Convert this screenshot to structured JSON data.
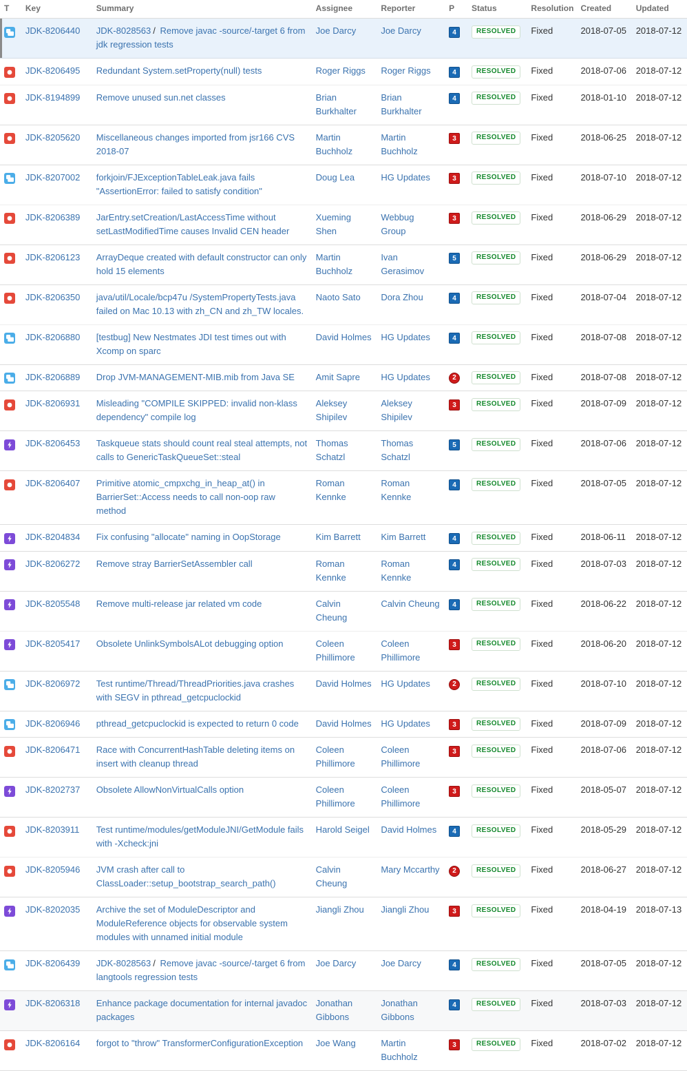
{
  "table": {
    "columns": [
      {
        "key": "type",
        "label": "T"
      },
      {
        "key": "key",
        "label": "Key"
      },
      {
        "key": "summary",
        "label": "Summary"
      },
      {
        "key": "assignee",
        "label": "Assignee"
      },
      {
        "key": "reporter",
        "label": "Reporter"
      },
      {
        "key": "priority",
        "label": "P"
      },
      {
        "key": "status",
        "label": "Status"
      },
      {
        "key": "resolution",
        "label": "Resolution"
      },
      {
        "key": "created",
        "label": "Created"
      },
      {
        "key": "updated",
        "label": "Updated"
      }
    ],
    "colors": {
      "link": "#3b73af",
      "subtask_icon": "#4bade8",
      "bug_icon": "#e5493a",
      "enhancement_icon": "#7d4bd8",
      "priority_blue": "#1b6bb5",
      "priority_red": "#cf1b1b",
      "status_resolved_text": "#14892c",
      "selected_row_bg": "#e9f2fb"
    },
    "rows": [
      {
        "type": "subtask",
        "type_label": "Sub-task",
        "key": "JDK-8206440",
        "summary_prefix": "JDK-8028563",
        "summary": "Remove javac -source/-target 6 from jdk regression tests",
        "assignee": "Joe Darcy",
        "reporter": "Joe Darcy",
        "priority": "4",
        "priority_shape": "square",
        "status": "RESOLVED",
        "resolution": "Fixed",
        "created": "2018-07-05",
        "updated": "2018-07-12",
        "selected": true,
        "alt": false,
        "sep": true
      },
      {
        "type": "bug",
        "type_label": "Bug",
        "key": "JDK-8206495",
        "summary_prefix": "",
        "summary": "Redundant System.setProperty(null) tests",
        "assignee": "Roger Riggs",
        "reporter": "Roger Riggs",
        "priority": "4",
        "priority_shape": "square",
        "status": "RESOLVED",
        "resolution": "Fixed",
        "created": "2018-07-06",
        "updated": "2018-07-12",
        "selected": false,
        "alt": false,
        "sep": false
      },
      {
        "type": "bug",
        "type_label": "Bug",
        "key": "JDK-8194899",
        "summary_prefix": "",
        "summary": "Remove unused sun.net classes",
        "assignee": "Brian Burkhalter",
        "reporter": "Brian Burkhalter",
        "priority": "4",
        "priority_shape": "square",
        "status": "RESOLVED",
        "resolution": "Fixed",
        "created": "2018-01-10",
        "updated": "2018-07-12",
        "selected": false,
        "alt": false,
        "sep": true
      },
      {
        "type": "bug",
        "type_label": "Bug",
        "key": "JDK-8205620",
        "summary_prefix": "",
        "summary": "Miscellaneous changes imported from jsr166 CVS 2018-07",
        "assignee": "Martin Buchholz",
        "reporter": "Martin Buchholz",
        "priority": "3",
        "priority_shape": "square",
        "status": "RESOLVED",
        "resolution": "Fixed",
        "created": "2018-06-25",
        "updated": "2018-07-12",
        "selected": false,
        "alt": false,
        "sep": true
      },
      {
        "type": "subtask",
        "type_label": "Sub-task",
        "key": "JDK-8207002",
        "summary_prefix": "",
        "summary": "forkjoin/FJExceptionTableLeak.java fails \"AssertionError: failed to satisfy condition\"",
        "assignee": "Doug Lea",
        "reporter": "HG Updates",
        "priority": "3",
        "priority_shape": "square",
        "status": "RESOLVED",
        "resolution": "Fixed",
        "created": "2018-07-10",
        "updated": "2018-07-12",
        "selected": false,
        "alt": false,
        "sep": false
      },
      {
        "type": "bug",
        "type_label": "Bug",
        "key": "JDK-8206389",
        "summary_prefix": "",
        "summary": "JarEntry.setCreation/LastAccessTime without setLastModifiedTime causes Invalid CEN header",
        "assignee": "Xueming Shen",
        "reporter": "Webbug Group",
        "priority": "3",
        "priority_shape": "square",
        "status": "RESOLVED",
        "resolution": "Fixed",
        "created": "2018-06-29",
        "updated": "2018-07-12",
        "selected": false,
        "alt": false,
        "sep": true
      },
      {
        "type": "bug",
        "type_label": "Bug",
        "key": "JDK-8206123",
        "summary_prefix": "",
        "summary": "ArrayDeque created with default constructor can only hold 15 elements",
        "assignee": "Martin Buchholz",
        "reporter": "Ivan Gerasimov",
        "priority": "5",
        "priority_shape": "square",
        "status": "RESOLVED",
        "resolution": "Fixed",
        "created": "2018-06-29",
        "updated": "2018-07-12",
        "selected": false,
        "alt": false,
        "sep": true
      },
      {
        "type": "bug",
        "type_label": "Bug",
        "key": "JDK-8206350",
        "summary_prefix": "",
        "summary": "java/util/Locale/bcp47u /SystemPropertyTests.java failed on Mac 10.13 with zh_CN and zh_TW locales.",
        "assignee": "Naoto Sato",
        "reporter": "Dora Zhou",
        "priority": "4",
        "priority_shape": "square",
        "status": "RESOLVED",
        "resolution": "Fixed",
        "created": "2018-07-04",
        "updated": "2018-07-12",
        "selected": false,
        "alt": false,
        "sep": false
      },
      {
        "type": "subtask",
        "type_label": "Sub-task",
        "key": "JDK-8206880",
        "summary_prefix": "",
        "summary": "[testbug] New Nestmates JDI test times out with Xcomp on sparc",
        "assignee": "David Holmes",
        "reporter": "HG Updates",
        "priority": "4",
        "priority_shape": "square",
        "status": "RESOLVED",
        "resolution": "Fixed",
        "created": "2018-07-08",
        "updated": "2018-07-12",
        "selected": false,
        "alt": false,
        "sep": true
      },
      {
        "type": "subtask",
        "type_label": "Sub-task",
        "key": "JDK-8206889",
        "summary_prefix": "",
        "summary": "Drop JVM-MANAGEMENT-MIB.mib from Java SE",
        "assignee": "Amit Sapre",
        "reporter": "HG Updates",
        "priority": "2",
        "priority_shape": "circle",
        "status": "RESOLVED",
        "resolution": "Fixed",
        "created": "2018-07-08",
        "updated": "2018-07-12",
        "selected": false,
        "alt": false,
        "sep": true
      },
      {
        "type": "bug",
        "type_label": "Bug",
        "key": "JDK-8206931",
        "summary_prefix": "",
        "summary": "Misleading \"COMPILE SKIPPED: invalid non-klass dependency\" compile log",
        "assignee": "Aleksey Shipilev",
        "reporter": "Aleksey Shipilev",
        "priority": "3",
        "priority_shape": "square",
        "status": "RESOLVED",
        "resolution": "Fixed",
        "created": "2018-07-09",
        "updated": "2018-07-12",
        "selected": false,
        "alt": false,
        "sep": true
      },
      {
        "type": "enhancement",
        "type_label": "Enhancement",
        "key": "JDK-8206453",
        "summary_prefix": "",
        "summary": "Taskqueue stats should count real steal attempts, not calls to GenericTaskQueueSet::steal",
        "assignee": "Thomas Schatzl",
        "reporter": "Thomas Schatzl",
        "priority": "5",
        "priority_shape": "square",
        "status": "RESOLVED",
        "resolution": "Fixed",
        "created": "2018-07-06",
        "updated": "2018-07-12",
        "selected": false,
        "alt": false,
        "sep": true
      },
      {
        "type": "bug",
        "type_label": "Bug",
        "key": "JDK-8206407",
        "summary_prefix": "",
        "summary": "Primitive atomic_cmpxchg_in_heap_at() in BarrierSet::Access needs to call non-oop raw method",
        "assignee": "Roman Kennke",
        "reporter": "Roman Kennke",
        "priority": "4",
        "priority_shape": "square",
        "status": "RESOLVED",
        "resolution": "Fixed",
        "created": "2018-07-05",
        "updated": "2018-07-12",
        "selected": false,
        "alt": false,
        "sep": true
      },
      {
        "type": "enhancement",
        "type_label": "Enhancement",
        "key": "JDK-8204834",
        "summary_prefix": "",
        "summary": "Fix confusing \"allocate\" naming in OopStorage",
        "assignee": "Kim Barrett",
        "reporter": "Kim Barrett",
        "priority": "4",
        "priority_shape": "square",
        "status": "RESOLVED",
        "resolution": "Fixed",
        "created": "2018-06-11",
        "updated": "2018-07-12",
        "selected": false,
        "alt": false,
        "sep": true
      },
      {
        "type": "enhancement",
        "type_label": "Enhancement",
        "key": "JDK-8206272",
        "summary_prefix": "",
        "summary": "Remove stray BarrierSetAssembler call",
        "assignee": "Roman Kennke",
        "reporter": "Roman Kennke",
        "priority": "4",
        "priority_shape": "square",
        "status": "RESOLVED",
        "resolution": "Fixed",
        "created": "2018-07-03",
        "updated": "2018-07-12",
        "selected": false,
        "alt": false,
        "sep": true
      },
      {
        "type": "enhancement",
        "type_label": "Enhancement",
        "key": "JDK-8205548",
        "summary_prefix": "",
        "summary": "Remove multi-release jar related vm code",
        "assignee": "Calvin Cheung",
        "reporter": "Calvin Cheung",
        "priority": "4",
        "priority_shape": "square",
        "status": "RESOLVED",
        "resolution": "Fixed",
        "created": "2018-06-22",
        "updated": "2018-07-12",
        "selected": false,
        "alt": false,
        "sep": false
      },
      {
        "type": "enhancement",
        "type_label": "Enhancement",
        "key": "JDK-8205417",
        "summary_prefix": "",
        "summary": "Obsolete UnlinkSymbolsALot debugging option",
        "assignee": "Coleen Phillimore",
        "reporter": "Coleen Phillimore",
        "priority": "3",
        "priority_shape": "square",
        "status": "RESOLVED",
        "resolution": "Fixed",
        "created": "2018-06-20",
        "updated": "2018-07-12",
        "selected": false,
        "alt": false,
        "sep": true
      },
      {
        "type": "subtask",
        "type_label": "Sub-task",
        "key": "JDK-8206972",
        "summary_prefix": "",
        "summary": "Test runtime/Thread/ThreadPriorities.java crashes with SEGV in pthread_getcpuclockid",
        "assignee": "David Holmes",
        "reporter": "HG Updates",
        "priority": "2",
        "priority_shape": "circle",
        "status": "RESOLVED",
        "resolution": "Fixed",
        "created": "2018-07-10",
        "updated": "2018-07-12",
        "selected": false,
        "alt": false,
        "sep": true
      },
      {
        "type": "subtask",
        "type_label": "Sub-task",
        "key": "JDK-8206946",
        "summary_prefix": "",
        "summary": "pthread_getcpuclockid is expected to return 0 code",
        "assignee": "David Holmes",
        "reporter": "HG Updates",
        "priority": "3",
        "priority_shape": "square",
        "status": "RESOLVED",
        "resolution": "Fixed",
        "created": "2018-07-09",
        "updated": "2018-07-12",
        "selected": false,
        "alt": false,
        "sep": true
      },
      {
        "type": "bug",
        "type_label": "Bug",
        "key": "JDK-8206471",
        "summary_prefix": "",
        "summary": "Race with ConcurrentHashTable deleting items on insert with cleanup thread",
        "assignee": "Coleen Phillimore",
        "reporter": "Coleen Phillimore",
        "priority": "3",
        "priority_shape": "square",
        "status": "RESOLVED",
        "resolution": "Fixed",
        "created": "2018-07-06",
        "updated": "2018-07-12",
        "selected": false,
        "alt": false,
        "sep": true
      },
      {
        "type": "enhancement",
        "type_label": "Enhancement",
        "key": "JDK-8202737",
        "summary_prefix": "",
        "summary": "Obsolete AllowNonVirtualCalls option",
        "assignee": "Coleen Phillimore",
        "reporter": "Coleen Phillimore",
        "priority": "3",
        "priority_shape": "square",
        "status": "RESOLVED",
        "resolution": "Fixed",
        "created": "2018-05-07",
        "updated": "2018-07-12",
        "selected": false,
        "alt": false,
        "sep": true
      },
      {
        "type": "bug",
        "type_label": "Bug",
        "key": "JDK-8203911",
        "summary_prefix": "",
        "summary": "Test runtime/modules/getModuleJNI/GetModule fails with -Xcheck:jni",
        "assignee": "Harold Seigel",
        "reporter": "David Holmes",
        "priority": "4",
        "priority_shape": "square",
        "status": "RESOLVED",
        "resolution": "Fixed",
        "created": "2018-05-29",
        "updated": "2018-07-12",
        "selected": false,
        "alt": false,
        "sep": false
      },
      {
        "type": "bug",
        "type_label": "Bug",
        "key": "JDK-8205946",
        "summary_prefix": "",
        "summary": "JVM crash after call to ClassLoader::setup_bootstrap_search_path()",
        "assignee": "Calvin Cheung",
        "reporter": "Mary Mccarthy",
        "priority": "2",
        "priority_shape": "circle",
        "status": "RESOLVED",
        "resolution": "Fixed",
        "created": "2018-06-27",
        "updated": "2018-07-12",
        "selected": false,
        "alt": false,
        "sep": true
      },
      {
        "type": "enhancement",
        "type_label": "Enhancement",
        "key": "JDK-8202035",
        "summary_prefix": "",
        "summary": "Archive the set of ModuleDescriptor and ModuleReference objects for observable system modules with unnamed initial module",
        "assignee": "Jiangli Zhou",
        "reporter": "Jiangli Zhou",
        "priority": "3",
        "priority_shape": "square",
        "status": "RESOLVED",
        "resolution": "Fixed",
        "created": "2018-04-19",
        "updated": "2018-07-13",
        "selected": false,
        "alt": false,
        "sep": true
      },
      {
        "type": "subtask",
        "type_label": "Sub-task",
        "key": "JDK-8206439",
        "summary_prefix": "JDK-8028563",
        "summary": "Remove javac -source/-target 6 from langtools regression tests",
        "assignee": "Joe Darcy",
        "reporter": "Joe Darcy",
        "priority": "4",
        "priority_shape": "square",
        "status": "RESOLVED",
        "resolution": "Fixed",
        "created": "2018-07-05",
        "updated": "2018-07-12",
        "selected": false,
        "alt": false,
        "sep": true
      },
      {
        "type": "enhancement",
        "type_label": "Enhancement",
        "key": "JDK-8206318",
        "summary_prefix": "",
        "summary": "Enhance package documentation for internal javadoc packages",
        "assignee": "Jonathan Gibbons",
        "reporter": "Jonathan Gibbons",
        "priority": "4",
        "priority_shape": "square",
        "status": "RESOLVED",
        "resolution": "Fixed",
        "created": "2018-07-03",
        "updated": "2018-07-12",
        "selected": false,
        "alt": true,
        "sep": true
      },
      {
        "type": "bug",
        "type_label": "Bug",
        "key": "JDK-8206164",
        "summary_prefix": "",
        "summary": "forgot to \"throw\" TransformerConfigurationException",
        "assignee": "Joe Wang",
        "reporter": "Martin Buchholz",
        "priority": "3",
        "priority_shape": "square",
        "status": "RESOLVED",
        "resolution": "Fixed",
        "created": "2018-07-02",
        "updated": "2018-07-12",
        "selected": false,
        "alt": false,
        "sep": true
      }
    ]
  }
}
